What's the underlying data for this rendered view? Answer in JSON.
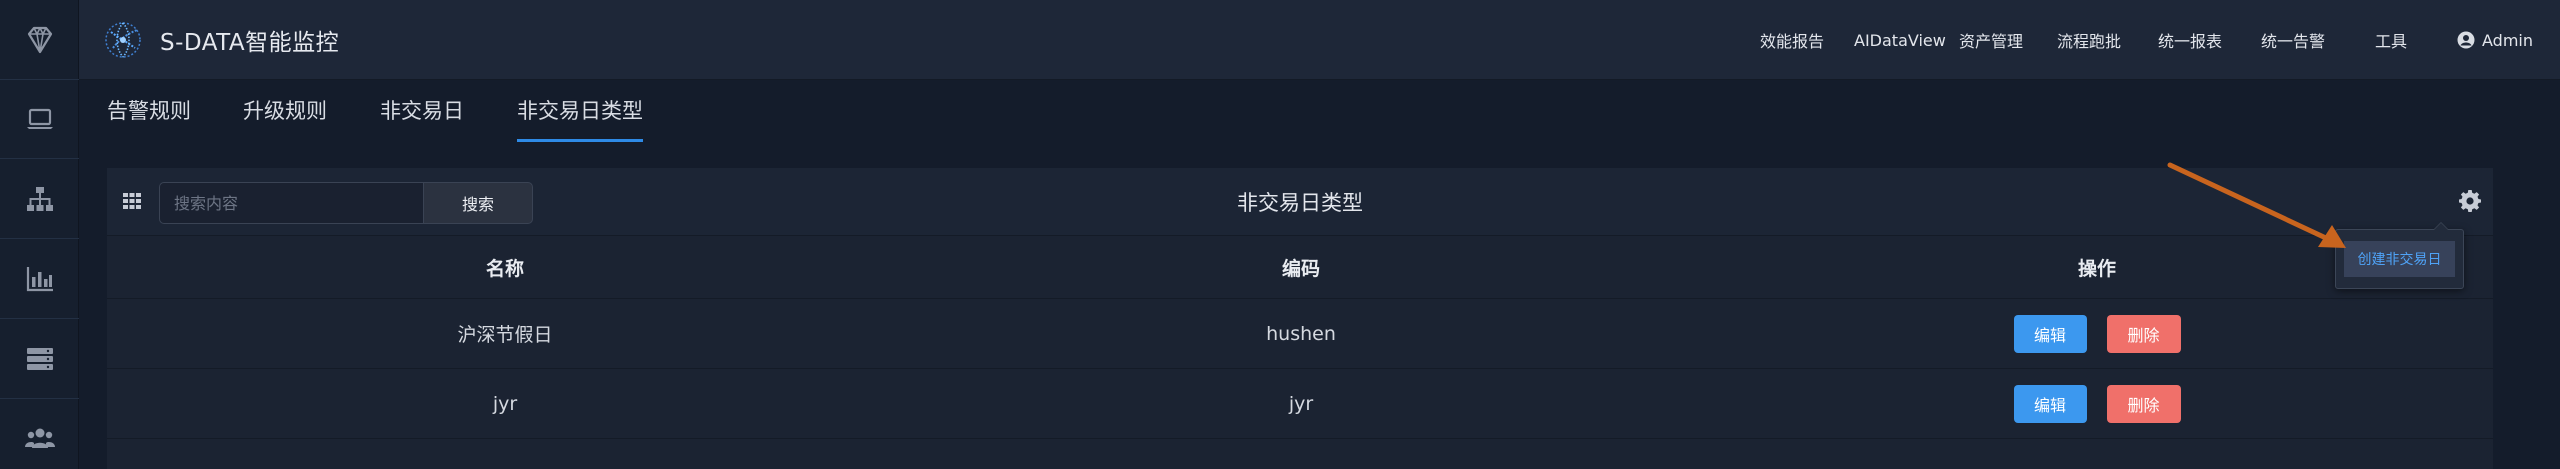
{
  "app": {
    "title": "S-DATA智能监控"
  },
  "rail": {
    "items": [
      {
        "icon": "diamond-icon"
      },
      {
        "icon": "monitor-icon"
      },
      {
        "icon": "sitemap-icon"
      },
      {
        "icon": "bar-chart-icon"
      },
      {
        "icon": "server-icon"
      },
      {
        "icon": "users-icon"
      }
    ]
  },
  "nav": {
    "items": [
      "效能报告",
      "AIDataView",
      "资产管理",
      "流程跑批",
      "统一报表",
      "统一告警",
      "工具"
    ],
    "user": "Admin"
  },
  "tabs": [
    {
      "label": "告警规则",
      "active": false
    },
    {
      "label": "升级规则",
      "active": false
    },
    {
      "label": "非交易日",
      "active": false
    },
    {
      "label": "非交易日类型",
      "active": true
    }
  ],
  "panel": {
    "title": "非交易日类型",
    "search_placeholder": "搜索内容",
    "search_value": "",
    "search_button": "搜索",
    "dropdown_item": "创建非交易日"
  },
  "table": {
    "columns": [
      "名称",
      "编码",
      "操作"
    ],
    "rows": [
      {
        "name": "沪深节假日",
        "code": "hushen",
        "edit": "编辑",
        "delete": "删除"
      },
      {
        "name": "jyr",
        "code": "jyr",
        "edit": "编辑",
        "delete": "删除"
      }
    ]
  },
  "colors": {
    "accent": "#2e8ae6",
    "edit_button": "#3c98ef",
    "delete_button": "#f0706a",
    "annotation_arrow": "#d2691e"
  }
}
